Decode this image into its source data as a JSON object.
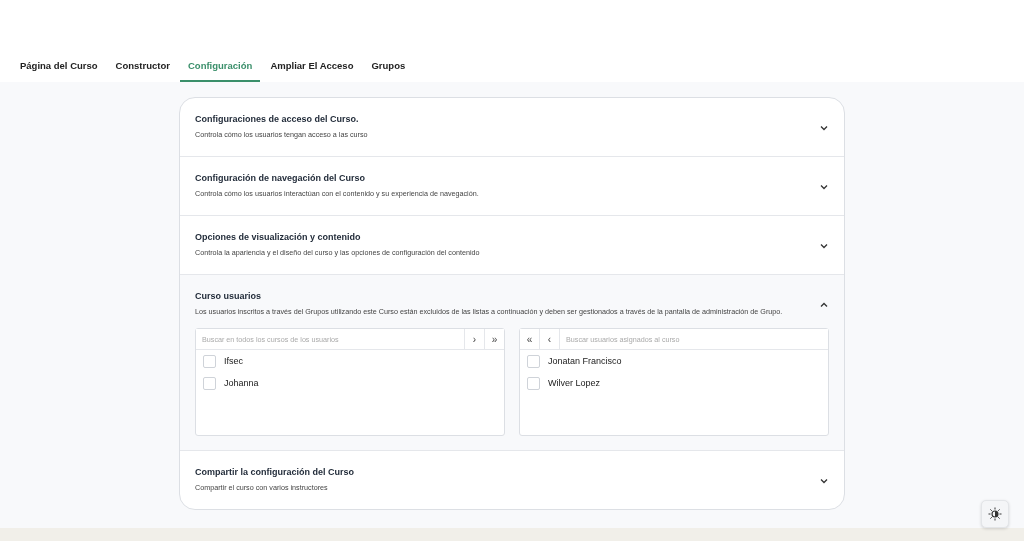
{
  "tabs": [
    {
      "label": "Página del Curso",
      "selected": false
    },
    {
      "label": "Constructor",
      "selected": false
    },
    {
      "label": "Configuración",
      "selected": true
    },
    {
      "label": "Ampliar El Acceso",
      "selected": false
    },
    {
      "label": "Grupos",
      "selected": false
    }
  ],
  "sections": [
    {
      "title": "Configuraciones de acceso del Curso.",
      "description": "Controla cómo los usuarios tengan acceso a las curso",
      "expanded": false
    },
    {
      "title": "Configuración de navegación del Curso",
      "description": "Controla cómo los usuarios interactúan con el contenido y su experiencia de navegación.",
      "expanded": false
    },
    {
      "title": "Opciones de visualización y contenido",
      "description": "Controla la apariencia y el diseño del curso y las opciones de configuración del contenido",
      "expanded": false
    },
    {
      "title": "Curso usuarios",
      "description": "Los usuarios inscritos a través del Grupos utilizando este Curso están excluidos de las listas a continuación y deben ser gestionados a través de la pantalla de administración de Grupo.",
      "expanded": true,
      "available": {
        "placeholder": "Buscar en todos los cursos de los usuarios",
        "buttons": [
          "›",
          "»"
        ],
        "users": [
          {
            "name": "Ifsec",
            "checked": false
          },
          {
            "name": "Johanna",
            "checked": false
          }
        ]
      },
      "assigned": {
        "placeholder": "Buscar usuarios asignados al curso",
        "buttons": [
          "«",
          "‹"
        ],
        "users": [
          {
            "name": "Jonatan Francisco",
            "checked": false
          },
          {
            "name": "Wilver Lopez",
            "checked": false
          }
        ]
      }
    },
    {
      "title": "Compartir la configuración del Curso",
      "description": "Compartir el curso con varios instructores",
      "expanded": false
    }
  ]
}
